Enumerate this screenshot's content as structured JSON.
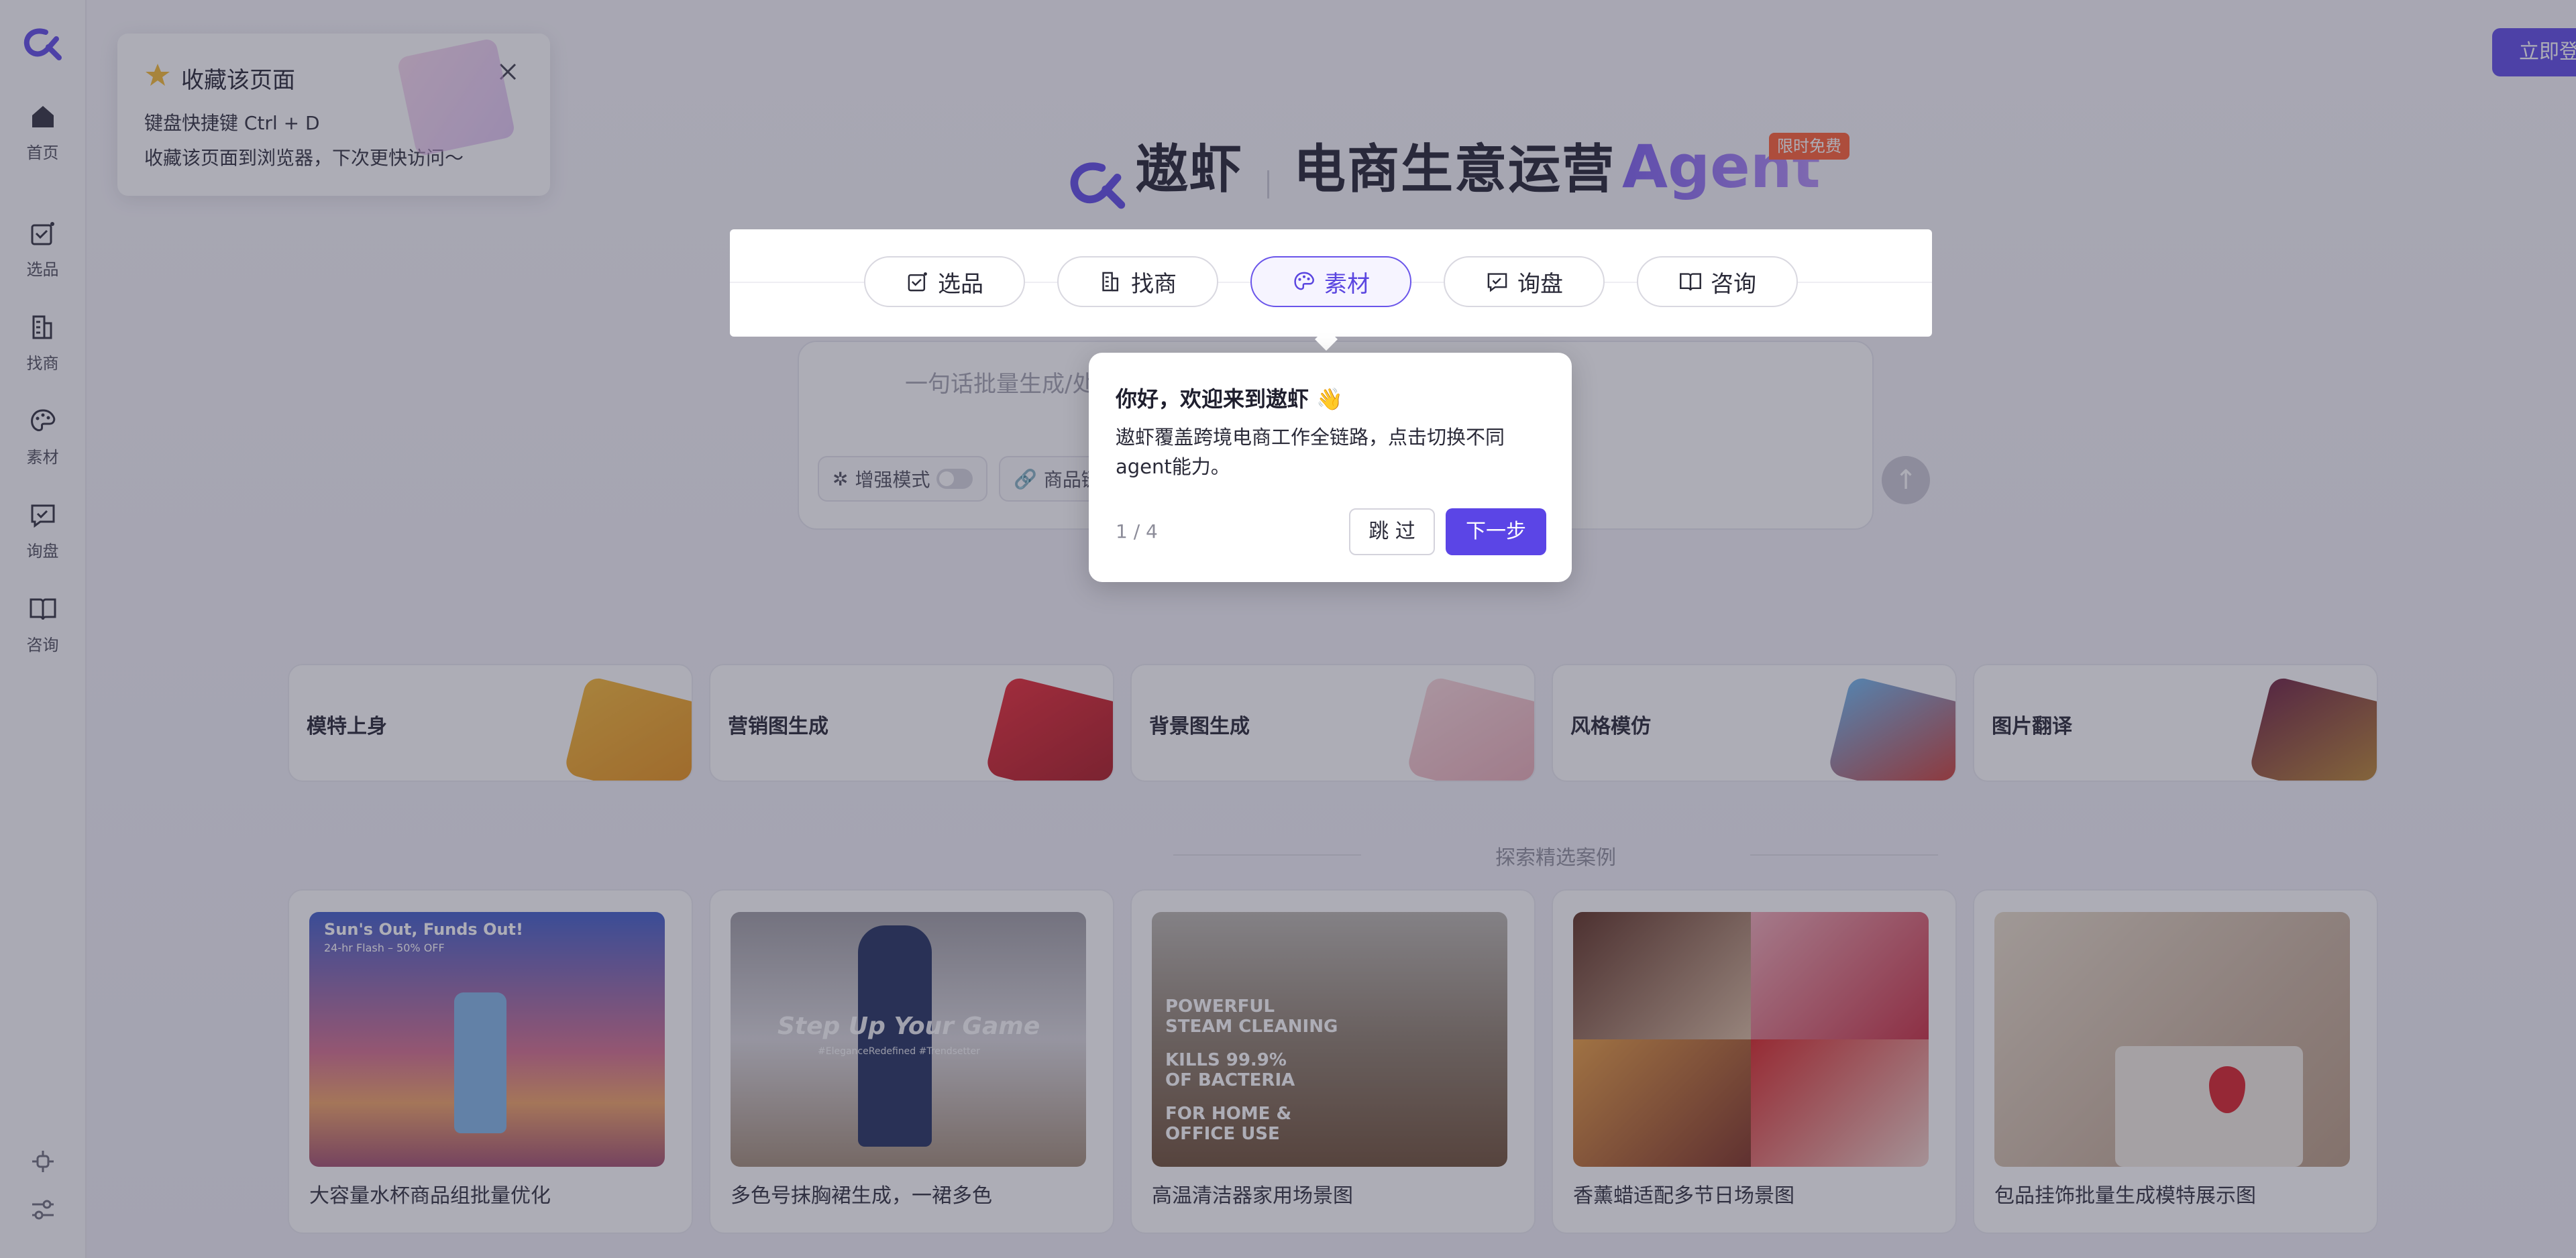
{
  "sidebar": {
    "items": [
      {
        "label": "首页",
        "icon": "home-icon"
      },
      {
        "label": "选品",
        "icon": "select-product-icon"
      },
      {
        "label": "找商",
        "icon": "building-icon"
      },
      {
        "label": "素材",
        "icon": "palette-icon"
      },
      {
        "label": "询盘",
        "icon": "inquiry-icon"
      },
      {
        "label": "咨询",
        "icon": "book-icon"
      }
    ],
    "bottom_icons": [
      "plugin-icon",
      "settings-sliders-icon"
    ]
  },
  "header": {
    "login_label": "立即登录",
    "brand": "遨虾",
    "subtitle": "电商生意运营",
    "agent_word": "Agent",
    "badge": "限时免费"
  },
  "tabs": [
    {
      "label": "选品",
      "icon": "select-product-icon",
      "active": false
    },
    {
      "label": "找商",
      "icon": "building-icon",
      "active": false
    },
    {
      "label": "素材",
      "icon": "palette-icon",
      "active": true
    },
    {
      "label": "询盘",
      "icon": "inquiry-icon",
      "active": false
    },
    {
      "label": "咨询",
      "icon": "book-icon",
      "active": false
    }
  ],
  "input": {
    "placeholder": "一句话批量生成/处理电商素材",
    "chip_enhance": "增强模式",
    "chip_link": "商品链"
  },
  "features": [
    {
      "label": "模特上身"
    },
    {
      "label": "营销图生成"
    },
    {
      "label": "背景图生成"
    },
    {
      "label": "风格模仿"
    },
    {
      "label": "图片翻译"
    }
  ],
  "section_title": "探索精选案例",
  "cases": [
    {
      "caption": "大容量水杯商品组批量优化",
      "img_text_1": "Sun's Out, Funds Out!",
      "img_text_2": "24-hr Flash – 50% OFF"
    },
    {
      "caption": "多色号抹胸裙生成，一裙多色",
      "img_text_1": "Step Up Your Game",
      "img_text_2": "#EleganceRedefined #Trendsetter"
    },
    {
      "caption": "高温清洁器家用场景图",
      "img_text_1": "POWERFUL",
      "img_text_2": "STEAM CLEANING",
      "img_text_3": "KILLS 99.9%",
      "img_text_4": "OF BACTERIA",
      "img_text_5": "FOR HOME &",
      "img_text_6": "OFFICE USE"
    },
    {
      "caption": "香薰蜡适配多节日场景图"
    },
    {
      "caption": "包品挂饰批量生成模特展示图"
    }
  ],
  "bookmark": {
    "title": "收藏该页面",
    "line1": "键盘快捷键  Ctrl + D",
    "line2": "收藏该页面到浏览器，下次更快访问～"
  },
  "guide": {
    "title": "你好，欢迎来到遨虾 👋",
    "body": "遨虾覆盖跨境电商工作全链路，点击切换不同agent能力。",
    "step": "1 / 4",
    "skip": "跳 过",
    "next": "下一步"
  },
  "colors": {
    "accent": "#5b45e6",
    "badge": "#ff5a2e",
    "overlay": "rgba(60,60,80,0.42)"
  }
}
